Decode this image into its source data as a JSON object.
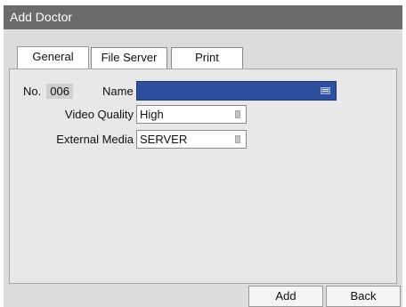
{
  "window": {
    "title": "Add Doctor"
  },
  "tabs": [
    {
      "label": "General",
      "active": true
    },
    {
      "label": "File Server",
      "active": false
    },
    {
      "label": "Print",
      "active": false
    }
  ],
  "form": {
    "no_label": "No.",
    "no_value": "006",
    "name_label": "Name",
    "name_value": "",
    "name_icon": "keyboard-icon",
    "video_quality_label": "Video Quality",
    "video_quality_value": "High",
    "external_media_label": "External Media",
    "external_media_value": "SERVER"
  },
  "buttons": {
    "add_label": "Add",
    "back_label": "Back"
  },
  "colors": {
    "titlebar": "#6b6b6b",
    "name_field": "#2f4f9e",
    "background": "#dcdcdc"
  }
}
